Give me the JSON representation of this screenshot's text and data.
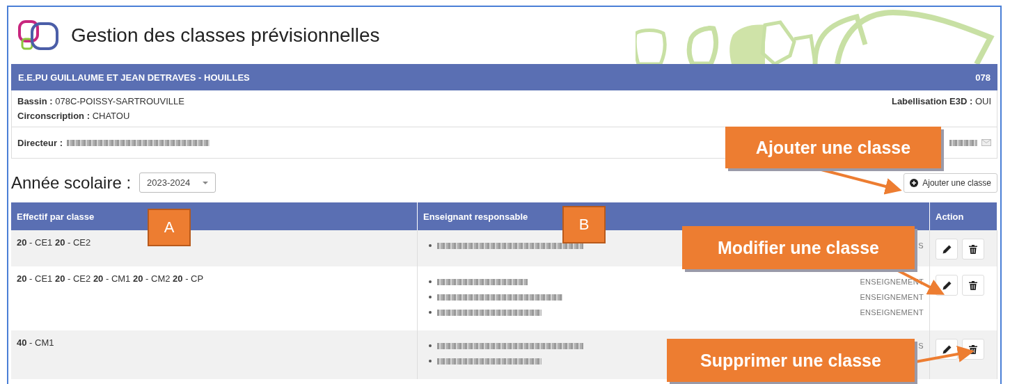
{
  "header": {
    "title": "Gestion des classes prévisionnelles"
  },
  "school": {
    "name": "E.E.PU GUILLAUME ET JEAN DETRAVES - HOUILLES",
    "code": "078"
  },
  "info": {
    "bassin_label": "Bassin :",
    "bassin": "078C-POISSY-SARTROUVILLE",
    "circ_label": "Circonscription :",
    "circ": "CHATOU",
    "e3d_label": "Labellisation E3D :",
    "e3d": "OUI",
    "director_label": "Directeur :"
  },
  "year": {
    "label": "Année scolaire :",
    "value": "2023-2024"
  },
  "add_button": "Ajouter une classe",
  "table": {
    "columns": [
      "Effectif par classe",
      "Enseignant responsable",
      "Action"
    ],
    "rows": [
      {
        "classes": "**20** - CE1 **20** - CE2",
        "teachers": [
          {
            "kind": "blurred",
            "role": "S"
          }
        ]
      },
      {
        "classes": "**20** - CE1 **20** - CE2 **20** - CM1 **20** - CM2 **20** - CP",
        "teachers": [
          {
            "kind": "blurred",
            "role": "ENSEIGNEMENT"
          },
          {
            "kind": "blurred",
            "role": "ENSEIGNEMENT"
          },
          {
            "kind": "blurred",
            "role": "ENSEIGNEMENT"
          }
        ]
      },
      {
        "classes": "**40** - CM1",
        "teachers": [
          {
            "kind": "blurred",
            "role": "S"
          },
          {
            "kind": "blurred"
          }
        ]
      }
    ]
  },
  "callouts": [
    {
      "text": "Ajouter une classe"
    },
    {
      "text": "Modifier une classe"
    },
    {
      "text": "Supprimer une classe"
    }
  ],
  "markers": [
    "A",
    "B"
  ]
}
